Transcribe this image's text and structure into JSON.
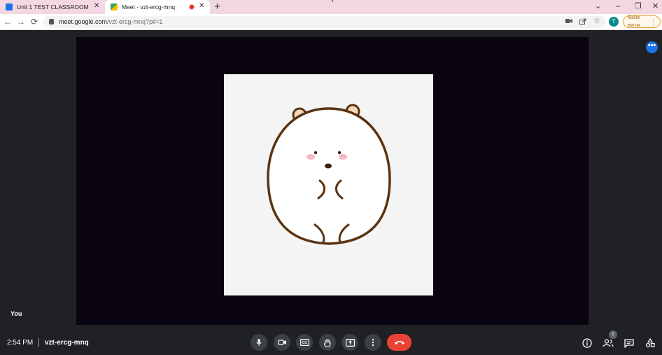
{
  "browser": {
    "tabs": [
      {
        "title": "Unit 1 TEST CLASSROOM",
        "close": "✕"
      },
      {
        "title": "Meet - vzt-ercg-mnq",
        "close": "✕",
        "recording": true
      }
    ],
    "new_tab": "+",
    "window_controls": {
      "chevron": "⌄",
      "minimize": "–",
      "restore": "❐",
      "close": "✕"
    },
    "nav": {
      "back": "←",
      "forward": "→",
      "reload": "⟳"
    },
    "url": {
      "host": "meet.google.com",
      "path": "/vzt-ercg-mnq?pli=1"
    },
    "profile_initial": "T",
    "update_button": {
      "label": "ข้อผิดพลาด",
      "menu": "⋮"
    }
  },
  "meet": {
    "self_label": "You",
    "more_options": "•••",
    "participant_avatar": {
      "description": "white bear illustration"
    },
    "bottom_bar": {
      "time": "2:54 PM",
      "meeting_code": "vzt-ercg-mnq",
      "participant_count": "1"
    }
  },
  "colors": {
    "tabstrip": "#f3d7e3",
    "meet_background": "#202124",
    "video_tile": "#0a0410",
    "control_button": "#3c4043",
    "hangup": "#ea4335",
    "accent": "#1a73e8"
  },
  "icons": [
    "mic-icon",
    "camera-icon",
    "captions-icon",
    "raise-hand-icon",
    "present-icon",
    "more-vert-icon",
    "call-end-icon",
    "info-icon",
    "people-icon",
    "chat-icon",
    "activities-icon"
  ]
}
